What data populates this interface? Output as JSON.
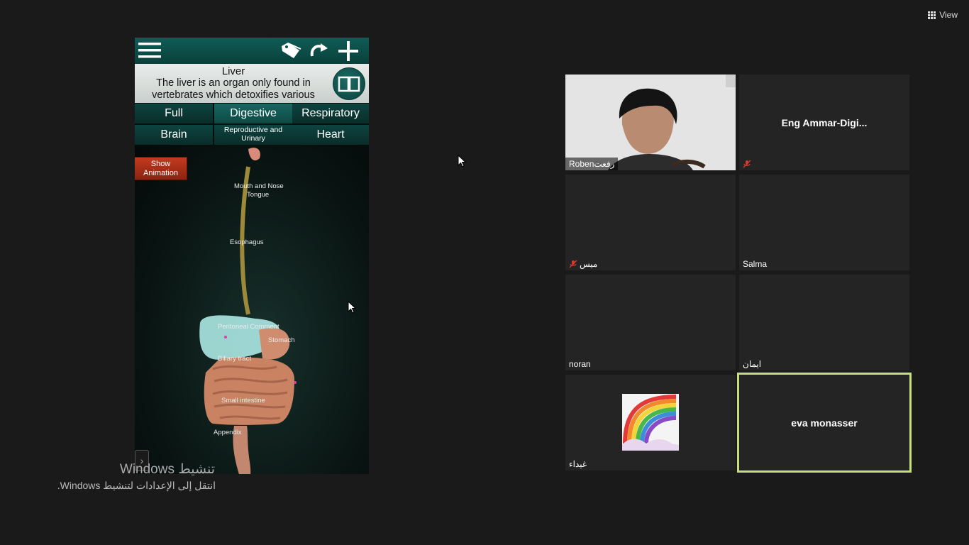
{
  "view_button": {
    "label": "View",
    "icon": "grid-icon"
  },
  "app": {
    "toolbar": {
      "icons": [
        "menu-icon",
        "tag-icon",
        "redo-icon",
        "plus-icon"
      ]
    },
    "info": {
      "title": "Liver",
      "text": "The liver is an organ only found in vertebrates which detoxifies various",
      "icon": "book-icon"
    },
    "tabs": [
      {
        "label": "Full"
      },
      {
        "label": "Digestive",
        "selected": true
      },
      {
        "label": "Respiratory"
      },
      {
        "label": "Brain"
      },
      {
        "label": "Reproductive and Urinary"
      },
      {
        "label": "Heart"
      }
    ],
    "show_animation": "Show Animation",
    "organ_labels": {
      "mouth": "Mouth and Nose",
      "tongue": "Tongue",
      "esophagus": "Esophagus",
      "peritoneum": "Peritoneal Comment",
      "stomach": "Stomach",
      "biliary": "Biliary tract",
      "small_intestine": "Small intestine",
      "appendix": "Appendix"
    }
  },
  "windows_watermark": {
    "title": "تنشيط Windows",
    "subtitle": "انتقل إلى الإعدادات لتنشيط Windows."
  },
  "participants": [
    {
      "name": "Robenرفعت",
      "video": true,
      "muted": false
    },
    {
      "name": "Eng  Ammar-Digi...",
      "video": false,
      "muted": true
    },
    {
      "name": "ميس",
      "video": false,
      "muted": true
    },
    {
      "name": "Salma",
      "video": false,
      "muted": false
    },
    {
      "name": "noran",
      "video": false,
      "muted": false
    },
    {
      "name": "ايمان",
      "video": false,
      "muted": false
    },
    {
      "name": "غيداء",
      "video": false,
      "muted": false,
      "avatar": "rainbow-drawing"
    },
    {
      "name": "eva monasser",
      "video": false,
      "muted": false,
      "active_speaker": true
    }
  ],
  "colors": {
    "active_border": "#c5df7a",
    "app_teal": "#0f5c55",
    "mute_red": "#d23b2e"
  }
}
